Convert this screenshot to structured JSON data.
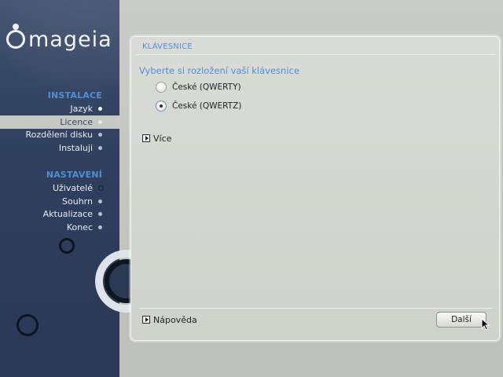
{
  "sidebar": {
    "logo_text": "mageia",
    "sections": [
      {
        "title": "INSTALACE",
        "items": [
          {
            "label": "Jazyk",
            "state": "done"
          },
          {
            "label": "Licence",
            "state": "active"
          },
          {
            "label": "Rozdělení disku",
            "state": "pending"
          },
          {
            "label": "Instaluji",
            "state": "pending"
          }
        ]
      },
      {
        "title": "NASTAVENÍ",
        "items": [
          {
            "label": "Uživatelé",
            "state": "pending"
          },
          {
            "label": "Souhrn",
            "state": "pending"
          },
          {
            "label": "Aktualizace",
            "state": "pending"
          },
          {
            "label": "Konec",
            "state": "pending"
          }
        ]
      }
    ]
  },
  "panel": {
    "title": "KLÁVESNICE",
    "prompt": "Vyberte si rozložení vaší klávesnice",
    "options": [
      {
        "label": "České (QWERTY)",
        "checked": false
      },
      {
        "label": "České (QWERTZ)",
        "checked": true
      }
    ],
    "more_label": "Více",
    "help_label": "Nápověda",
    "next_label": "Další"
  },
  "colors": {
    "accent": "#4f8fd6",
    "sidebar_bg": "#33435f",
    "panel_bg": "#d6d8d3"
  }
}
